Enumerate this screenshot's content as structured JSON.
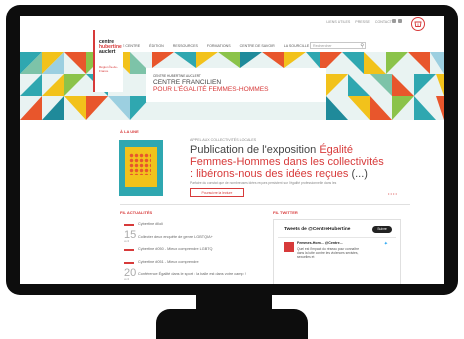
{
  "top_links": [
    "LIENS UTILES",
    "PRESSE",
    "CONTACT"
  ],
  "cart_count": "0",
  "logo": {
    "line1": "centre",
    "line2": "hubertine",
    "line3": "auclert",
    "tagline": "Région Île-de-France"
  },
  "nav": [
    "LE CENTRE",
    "ÉDITION",
    "RESSOURCES",
    "FORMATIONS",
    "CENTRE DE SAVOIR",
    "LA SOURCILLE"
  ],
  "search": {
    "placeholder": "Rechercher"
  },
  "banner": {
    "small": "CENTRE HUBERTINE AUCLERT",
    "title_1": "CENTRE FRANCILIEN",
    "title_2": "POUR L'ÉGALITÉ FEMMES-HOMMES"
  },
  "featured": {
    "section": "À LA UNE",
    "kicker": "APPEL AUX COLLECTIVITÉS LOCALES",
    "title_a": "Publication de l'exposition",
    "title_b": "Égalité Femmes-Hommes dans les collectivités : libérons-nous des idées reçues",
    "title_c": "(...)",
    "description": "Parfaire du constat que de nombreuses idées reçues persistent sur l'égalité professionnelle dans les",
    "read_more": "Poursuivre la lecture",
    "pager": "• • • •"
  },
  "news": {
    "section": "FIL ACTUALITÉS",
    "items": [
      {
        "date": "",
        "month": "",
        "text": "Cybertine #lloli"
      },
      {
        "date": "15",
        "month": "avril",
        "text": "Collecter deux enquête de genre LGBTQIA+"
      },
      {
        "date": "",
        "month": "",
        "text": "Cybertine #050 - Mieux comprendre LGBTQ"
      },
      {
        "date": "",
        "month": "",
        "text": "Cybertine #051 - Mieux comprendre"
      },
      {
        "date": "20",
        "month": "avril",
        "text": "Conférence Égalité dans le sport : la balle est dans votre camp !"
      }
    ]
  },
  "twitter": {
    "section": "FIL TWITTER",
    "title": "Tweets de @CentreHubertine",
    "follow": "Suivre",
    "name": "Femmes-Hom... @Centre...",
    "body": "Quel est l'impact du réseau pour connaître dans la lutte contre les violences sexistes, sexuelles et"
  },
  "colors": {
    "accent": "#d73a3a",
    "twitter": "#1da1f2",
    "frame": "#0d0d0d"
  }
}
